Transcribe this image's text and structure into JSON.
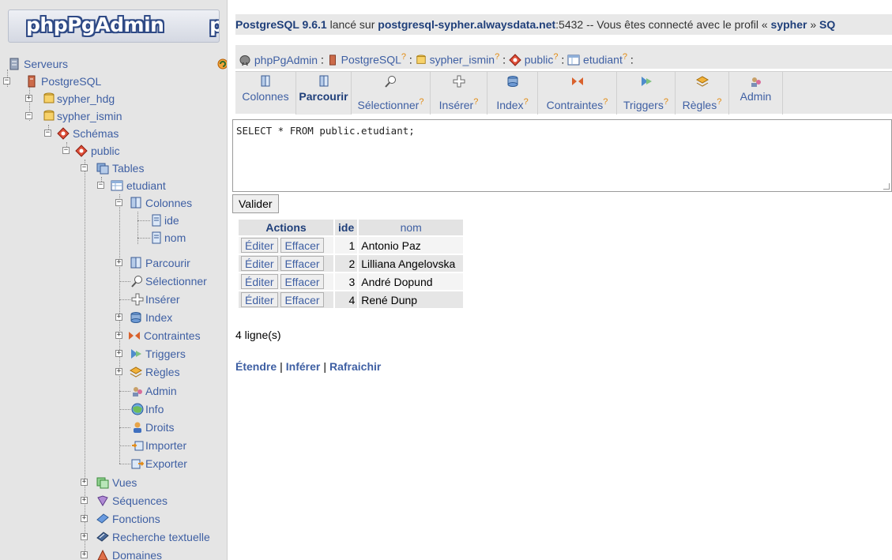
{
  "logo": {
    "text": "phpPgAdmin",
    "text_cut": "p"
  },
  "tree": {
    "servers": "Serveurs",
    "server": "PostgreSQL",
    "databases": [
      "sypher_hdg",
      "sypher_ismin"
    ],
    "schemas": "Schémas",
    "schema": "public",
    "tables": "Tables",
    "table": "etudiant",
    "columns": "Colonnes",
    "column_items": [
      "ide",
      "nom"
    ],
    "table_actions": [
      "Parcourir",
      "Sélectionner",
      "Insérer",
      "Index",
      "Contraintes",
      "Triggers",
      "Règles",
      "Admin",
      "Info",
      "Droits",
      "Importer",
      "Exporter"
    ],
    "schema_items": [
      "Vues",
      "Séquences",
      "Fonctions",
      "Recherche textuelle",
      "Domaines"
    ]
  },
  "topbar": {
    "server": "PostgreSQL 9.6.1",
    "text1": " lancé sur ",
    "host": "postgresql-sypher.alwaysdata.net",
    "text2": ":5432 -- Vous êtes connecté avec le profil « ",
    "user": "sypher",
    "text3": " »  ",
    "cut": "SQ"
  },
  "breadcrumb": [
    "phpPgAdmin",
    "PostgreSQL",
    "sypher_ismin",
    "public",
    "etudiant"
  ],
  "breadcrumb_help": "?",
  "toolbar": {
    "tabs": [
      "Colonnes",
      "Parcourir",
      "Sélectionner",
      "Insérer",
      "Index",
      "Contraintes",
      "Triggers",
      "Règles",
      "Admin"
    ],
    "active": "Parcourir"
  },
  "sql": {
    "query": "SELECT * FROM public.etudiant;",
    "submit_label": "Valider"
  },
  "results": {
    "headers": {
      "actions": "Actions",
      "ide": "ide",
      "nom": "nom"
    },
    "edit_label": "Éditer",
    "delete_label": "Effacer",
    "rows": [
      {
        "ide": "1",
        "nom": "Antonio Paz"
      },
      {
        "ide": "2",
        "nom": "Lilliana Angelovska"
      },
      {
        "ide": "3",
        "nom": "André Dopund"
      },
      {
        "ide": "4",
        "nom": "René Dunp"
      }
    ],
    "count": "4 ligne(s)"
  },
  "links": [
    "Étendre",
    "Inférer",
    "Rafraichir"
  ],
  "links_sep": "|"
}
